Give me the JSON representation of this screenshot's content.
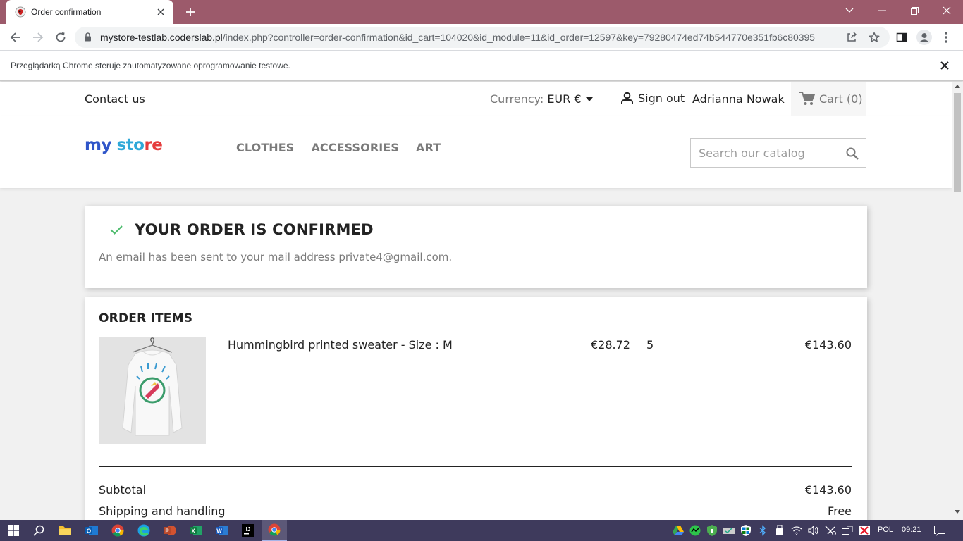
{
  "browser": {
    "tab_title": "Order confirmation",
    "url_host": "mystore-testlab.coderslab.pl",
    "url_path": "/index.php?controller=order-confirmation&id_cart=104020&id_module=11&id_order=12597&key=79280474ed74b544770e351fb6c80395",
    "infobar_text": "Przeglądarką Chrome steruje zautomatyzowane oprogramowanie testowe."
  },
  "header": {
    "contact_label": "Contact us",
    "currency_label": "Currency:",
    "currency_value": "EUR €",
    "signout_label": "Sign out",
    "user_name": "Adrianna Nowak",
    "cart_label": "Cart (0)"
  },
  "logo": {
    "part1": "my ",
    "part2": "sto",
    "part3": "re"
  },
  "menu": {
    "items": [
      "CLOTHES",
      "ACCESSORIES",
      "ART"
    ]
  },
  "search": {
    "placeholder": "Search our catalog"
  },
  "confirmation": {
    "title": "YOUR ORDER IS CONFIRMED",
    "email_text": "An email has been sent to your mail address private4@gmail.com."
  },
  "order": {
    "heading": "ORDER ITEMS",
    "item": {
      "name": "Hummingbird printed sweater - Size : M",
      "unit_price": "€28.72",
      "quantity": "5",
      "total": "€143.60"
    },
    "subtotal_label": "Subtotal",
    "subtotal_value": "€143.60",
    "shipping_label": "Shipping and handling",
    "shipping_value": "Free"
  },
  "taskbar": {
    "language": "POL",
    "time": "09:21"
  },
  "colors": {
    "tab_strip": "#9c5a6b",
    "taskbar": "#3e3a5c",
    "check_green": "#4cbb6c",
    "logo_blue": "#2f55c9",
    "logo_cyan": "#2fa8d8",
    "logo_red": "#e53c3c"
  }
}
